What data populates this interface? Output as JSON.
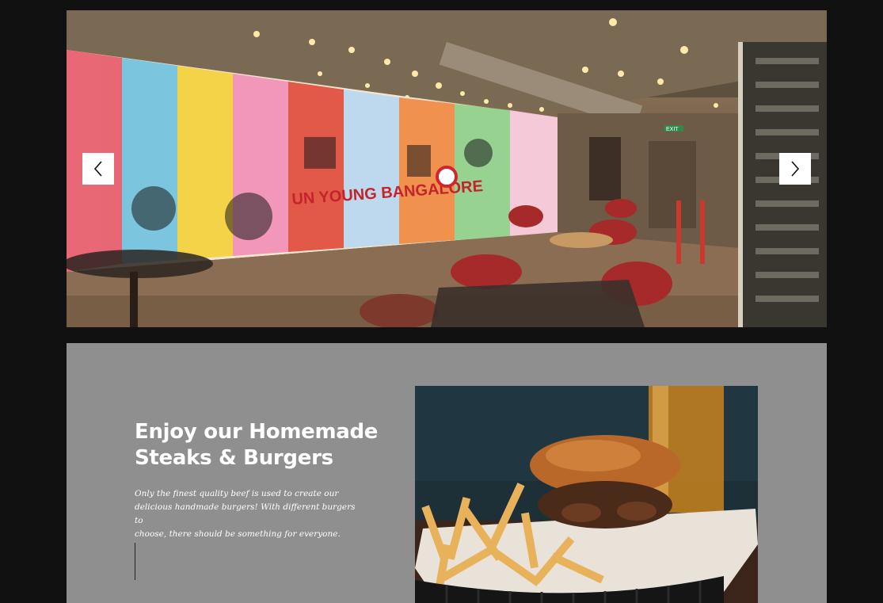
{
  "hero": {
    "image_icon": "restaurant-interior-photo",
    "mural_sign_text": "UN YOUNG BANGALORE",
    "exit_sign_text": "EXIT",
    "prev_icon": "chevron-left-icon",
    "next_icon": "chevron-right-icon"
  },
  "feature": {
    "title_line1": "Enjoy our Homemade",
    "title_line2": "Steaks & Burgers",
    "text_line1": "Only the finest quality beef is used to create our",
    "text_line2": "delicious handmade burgers! With different burgers to",
    "text_line3": "choose, there should be something for everyone.",
    "photo_icon": "burger-and-fries-photo"
  },
  "colors": {
    "page_bg": "#111111",
    "section_bg": "#8f8f8f",
    "heading": "#ffffff",
    "arrow_bg": "#ffffff"
  }
}
